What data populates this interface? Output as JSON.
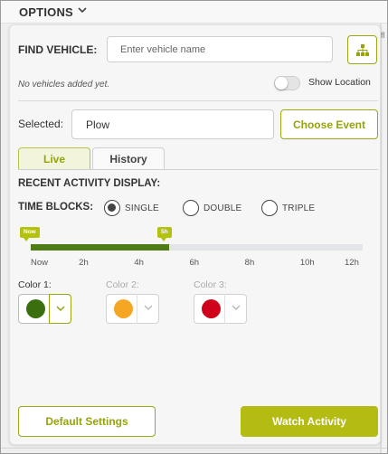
{
  "header": {
    "title": "OPTIONS"
  },
  "find_vehicle": {
    "label": "FIND VEHICLE:",
    "placeholder": "Enter vehicle name",
    "tree_icon": "hierarchy-icon",
    "empty_message": "No vehicles added yet.",
    "show_location_label": "Show Location",
    "show_location_on": false
  },
  "selected": {
    "label": "Selected:",
    "value": "Plow",
    "choose_event_label": "Choose Event"
  },
  "tabs": [
    {
      "label": "Live",
      "active": true
    },
    {
      "label": "History",
      "active": false
    }
  ],
  "recent_activity": {
    "title": "RECENT ACTIVITY DISPLAY:",
    "time_blocks_label": "TIME BLOCKS:",
    "options": [
      {
        "label": "SINGLE",
        "checked": true
      },
      {
        "label": "DOUBLE",
        "checked": false
      },
      {
        "label": "TRIPLE",
        "checked": false
      }
    ]
  },
  "timeline": {
    "max_hours": 12,
    "ticks": [
      "Now",
      "2h",
      "4h",
      "6h",
      "8h",
      "10h",
      "12h"
    ],
    "start_flag": "Now",
    "end_flag": "5h",
    "filled_hours": 5,
    "fill_color": "#4f7c14",
    "accent_color": "#b4c10f"
  },
  "colors": [
    {
      "label": "Color 1:",
      "color": "#3b6e0e",
      "enabled": true
    },
    {
      "label": "Color 2:",
      "color": "#f5a623",
      "enabled": false
    },
    {
      "label": "Color 3:",
      "color": "#d0021b",
      "enabled": false
    }
  ],
  "footer": {
    "default_settings_label": "Default Settings",
    "watch_activity_label": "Watch Activity"
  },
  "map_text": {
    "side_label": "fl"
  }
}
